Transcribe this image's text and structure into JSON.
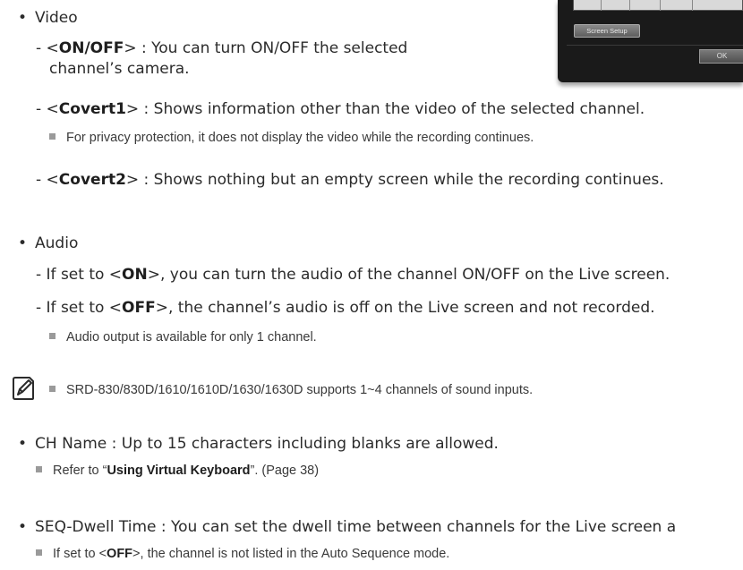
{
  "video": {
    "heading": "Video",
    "onoff": {
      "pre": "- <",
      "term": "ON/OFF",
      "post": "> : You can turn ON/OFF the selected",
      "cont": "channel’s camera."
    },
    "covert1": {
      "pre": "- <",
      "term": "Covert1",
      "post": "> : Shows information other than the video of the selected channel."
    },
    "covert1_note": "For privacy protection, it does not display the video while the recording continues.",
    "covert2": {
      "pre": "- <",
      "term": "Covert2",
      "post": "> : Shows nothing but an empty screen while the recording continues."
    }
  },
  "audio": {
    "heading": "Audio",
    "on": {
      "pre": "- If set to <",
      "term": "ON",
      "post": ">, you can turn the audio of the channel ON/OFF on the Live screen."
    },
    "off": {
      "pre": "- If set to <",
      "term": "OFF",
      "post": ">, the channel’s audio is off on the Live screen and not recorded."
    },
    "off_note": "Audio output is available for only 1 channel."
  },
  "memo_note": "SRD-830/830D/1610/1610D/1630/1630D supports 1~4 channels of sound inputs.",
  "ch_name": {
    "text": "CH Name : Up to 15 characters including blanks are allowed.",
    "note_pre": "Refer to “",
    "note_term": "Using Virtual Keyboard",
    "note_post": "”. (Page 38)"
  },
  "seq": {
    "text": "SEQ-Dwell Time : You can set the dwell time between channels for the Live screen a",
    "note_pre": "If set to <",
    "note_term": "OFF",
    "note_post": ">, the channel is not listed in the Auto Sequence mode."
  },
  "screen": {
    "setup_button": "Screen Setup",
    "ok_button": "OK"
  }
}
